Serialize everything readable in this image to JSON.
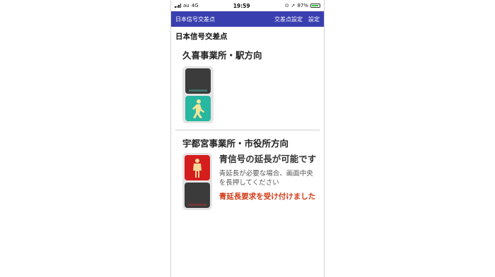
{
  "status_bar": {
    "carrier": "au",
    "network": "4G",
    "time": "19:59",
    "battery": "87%"
  },
  "nav_bar": {
    "title": "日本信号交差点",
    "intersection_settings": "交差点設定",
    "settings": "設定",
    "background": "#3a3fb0"
  },
  "main": {
    "title": "日本信号交差点",
    "directions": [
      {
        "name": "久喜事業所・駅方向",
        "signal": {
          "upper": "off",
          "lower": "green-walk"
        }
      },
      {
        "name": "宇都宮事業所・市役所方向",
        "signal": {
          "upper": "red-stop",
          "lower": "off"
        },
        "info": {
          "headline": "青信号の延長が可能です",
          "description": "青延長が必要な場合、画面中央を長押してください",
          "warning": "青延長要求を受け付けました"
        }
      }
    ]
  },
  "colors": {
    "walk_green": "#28b7a0",
    "stop_red": "#d51d1d",
    "warning_text": "#d03a16"
  }
}
